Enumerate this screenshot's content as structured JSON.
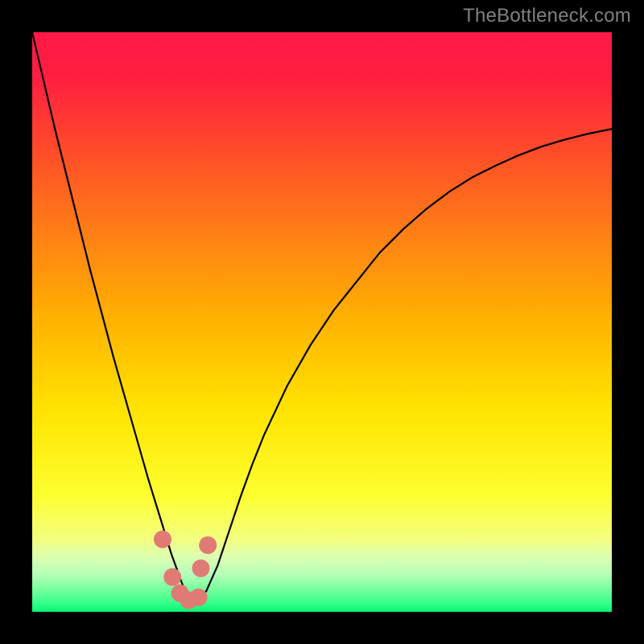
{
  "watermark": "TheBottleneck.com",
  "chart_data": {
    "type": "line",
    "title": "",
    "xlabel": "",
    "ylabel": "",
    "xlim": [
      0,
      100
    ],
    "ylim": [
      0,
      100
    ],
    "grid": false,
    "series": [
      {
        "name": "bottleneck-curve",
        "x": [
          0,
          2,
          4,
          6,
          8,
          10,
          12,
          14,
          16,
          18,
          20,
          22,
          24,
          26,
          27,
          28,
          30,
          32,
          34,
          36,
          38,
          40,
          44,
          48,
          52,
          56,
          60,
          64,
          68,
          72,
          76,
          80,
          84,
          88,
          92,
          96,
          100
        ],
        "y": [
          100,
          91.5,
          83,
          75,
          67,
          59,
          51.5,
          44,
          37,
          30,
          23,
          16.5,
          10,
          4.5,
          2,
          2,
          3.5,
          8,
          14,
          20,
          25.5,
          30.5,
          39,
          46,
          52,
          57,
          62,
          66,
          69.5,
          72.5,
          75,
          77,
          78.8,
          80.3,
          81.5,
          82.5,
          83.3
        ]
      }
    ],
    "markers": {
      "name": "highlight-points",
      "color": "#e07a75",
      "x": [
        22.5,
        24.2,
        25.5,
        27.0,
        28.7,
        29.1,
        30.3
      ],
      "y": [
        12.5,
        6.0,
        3.2,
        2.0,
        2.5,
        7.5,
        11.5
      ]
    },
    "background_gradient": {
      "stops": [
        {
          "offset": 0.0,
          "color": "#ff1948"
        },
        {
          "offset": 0.08,
          "color": "#ff1f40"
        },
        {
          "offset": 0.2,
          "color": "#ff4a2a"
        },
        {
          "offset": 0.35,
          "color": "#ff8015"
        },
        {
          "offset": 0.5,
          "color": "#ffb300"
        },
        {
          "offset": 0.65,
          "color": "#ffe300"
        },
        {
          "offset": 0.8,
          "color": "#fdff30"
        },
        {
          "offset": 0.875,
          "color": "#f3ff80"
        },
        {
          "offset": 0.905,
          "color": "#dcffb0"
        },
        {
          "offset": 0.935,
          "color": "#b5ffb8"
        },
        {
          "offset": 0.96,
          "color": "#7affa0"
        },
        {
          "offset": 0.985,
          "color": "#35ff8a"
        },
        {
          "offset": 1.0,
          "color": "#08f573"
        }
      ]
    }
  }
}
